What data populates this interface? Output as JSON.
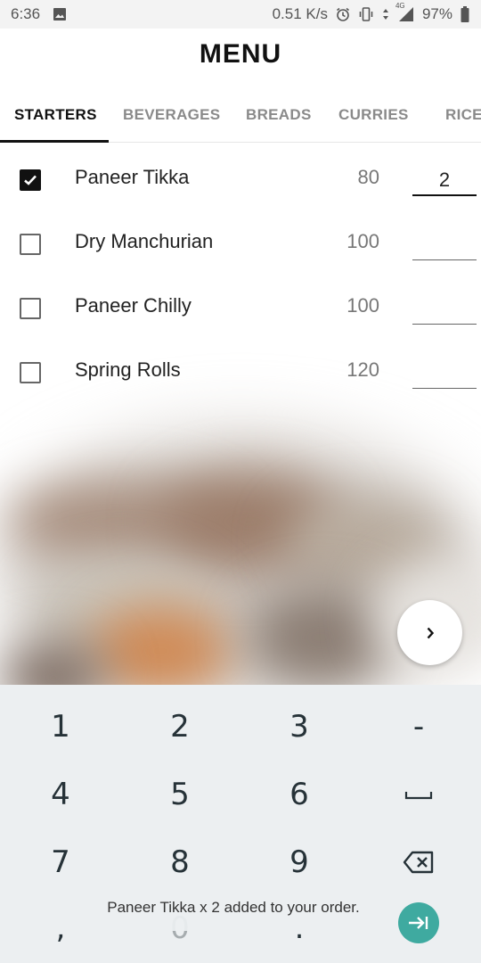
{
  "status_bar": {
    "time": "6:36",
    "network_speed": "0.51 K/s",
    "network_type": "4G",
    "battery": "97%",
    "icons": [
      "image-icon",
      "alarm-icon",
      "vibrate-icon",
      "data-arrows-icon",
      "signal-icon",
      "battery-icon"
    ]
  },
  "header": {
    "title": "MENU"
  },
  "tabs": [
    {
      "label": "STARTERS",
      "active": true
    },
    {
      "label": "BEVERAGES",
      "active": false
    },
    {
      "label": "BREADS",
      "active": false
    },
    {
      "label": "CURRIES",
      "active": false
    },
    {
      "label": "RICE",
      "active": false
    }
  ],
  "menu_items": [
    {
      "name": "Paneer Tikka",
      "price": "80",
      "checked": true,
      "quantity": "2"
    },
    {
      "name": "Dry Manchurian",
      "price": "100",
      "checked": false,
      "quantity": ""
    },
    {
      "name": "Paneer Chilly",
      "price": "100",
      "checked": false,
      "quantity": ""
    },
    {
      "name": "Spring Rolls",
      "price": "120",
      "checked": false,
      "quantity": ""
    }
  ],
  "next_button": {
    "icon": "chevron-right-icon"
  },
  "keyboard": {
    "rows": [
      [
        "1",
        "2",
        "3",
        "-"
      ],
      [
        "4",
        "5",
        "6",
        "space"
      ],
      [
        "7",
        "8",
        "9",
        "backspace"
      ],
      [
        ",",
        "0",
        ".",
        "enter"
      ]
    ],
    "icons": {
      "space": "space-icon",
      "backspace": "backspace-icon",
      "enter": "enter-icon"
    }
  },
  "toast": {
    "message": "Paneer Tikka x 2 added to your order."
  },
  "colors": {
    "accent": "#111111",
    "tab_inactive": "#8a8a8a",
    "keyboard_bg": "#eceff1",
    "enter_key": "#3faaa0",
    "status_bar_bg": "#f3f3f3"
  }
}
